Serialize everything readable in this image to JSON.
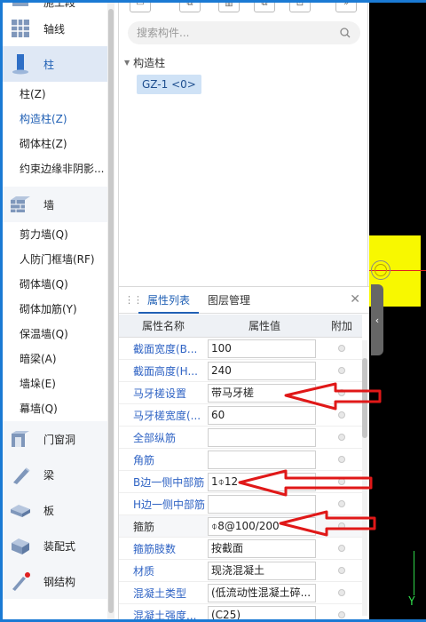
{
  "left_nav": {
    "top_cut_label": "施工段",
    "categories": {
      "axis": "轴线",
      "column": "柱",
      "wall": "墙",
      "opening": "门窗洞",
      "beam": "梁",
      "slab": "板",
      "prefab": "装配式",
      "steel": "钢结构"
    },
    "column_items": [
      "柱(Z)",
      "构造柱(Z)",
      "砌体柱(Z)",
      "约束边缘非阴影..."
    ],
    "wall_items": [
      "剪力墙(Q)",
      "人防门框墙(RF)",
      "砌体墙(Q)",
      "砌体加筋(Y)",
      "保温墙(Q)",
      "暗梁(A)",
      "墙垛(E)",
      "幕墙(Q)"
    ]
  },
  "search": {
    "placeholder": "搜索构件..."
  },
  "tree": {
    "root": "构造柱",
    "item": "GZ-1 <0>"
  },
  "props": {
    "tab_properties": "属性列表",
    "tab_layers": "图层管理",
    "col_name": "属性名称",
    "col_value": "属性值",
    "col_extra": "附加",
    "rows": [
      {
        "name": "截面宽度(B...",
        "value": "100"
      },
      {
        "name": "截面高度(H...",
        "value": "240"
      },
      {
        "name": "马牙槎设置",
        "value": "带马牙槎"
      },
      {
        "name": "马牙槎宽度(...",
        "value": "60"
      },
      {
        "name": "全部纵筋",
        "value": ""
      },
      {
        "name": "角筋",
        "value": ""
      },
      {
        "name": "B边一侧中部筋",
        "value": "1⌽12"
      },
      {
        "name": "H边一侧中部筋",
        "value": ""
      },
      {
        "name": "箍筋",
        "value": "⌽8@100/200"
      },
      {
        "name": "箍筋肢数",
        "value": "按截面"
      },
      {
        "name": "材质",
        "value": "现浇混凝土"
      },
      {
        "name": "混凝土类型",
        "value": "(低流动性混凝土碎..."
      },
      {
        "name": "混凝土强度...",
        "value": "(C25)"
      }
    ]
  },
  "canvas": {
    "axis_label": "Y"
  },
  "colors": {
    "accent_blue": "#1f5fb4",
    "annotation_red": "#e01818",
    "highlight_yellow": "#f8f800"
  }
}
